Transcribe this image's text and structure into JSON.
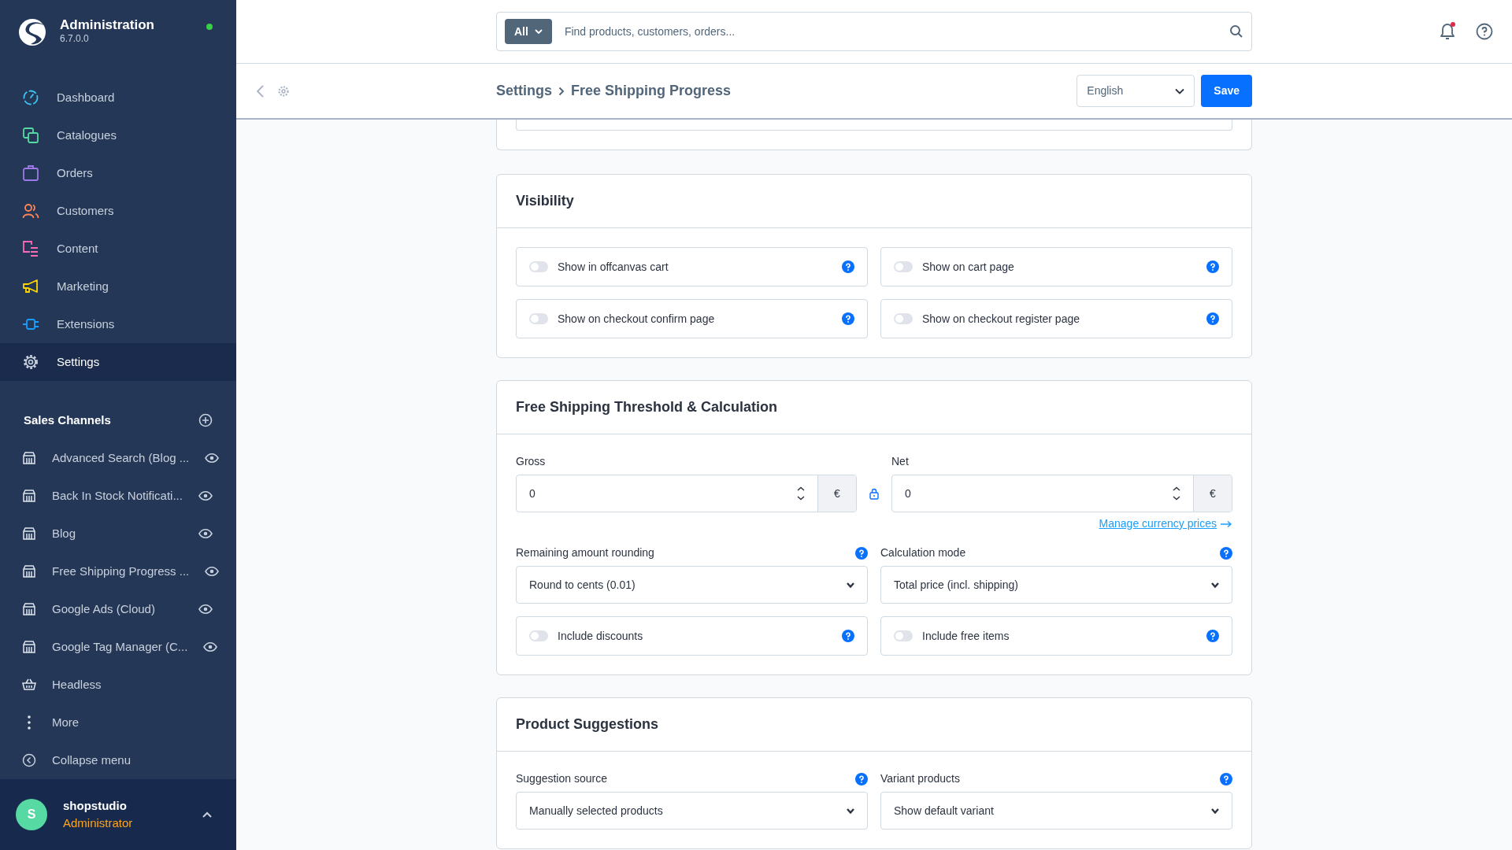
{
  "sidebar": {
    "brand": {
      "title": "Administration",
      "version": "6.7.0.0",
      "online": true
    },
    "nav": [
      {
        "label": "Dashboard",
        "selected": false
      },
      {
        "label": "Catalogues",
        "selected": false
      },
      {
        "label": "Orders",
        "selected": false
      },
      {
        "label": "Customers",
        "selected": false
      },
      {
        "label": "Content",
        "selected": false
      },
      {
        "label": "Marketing",
        "selected": false
      },
      {
        "label": "Extensions",
        "selected": false
      },
      {
        "label": "Settings",
        "selected": true
      }
    ],
    "sales_channels": {
      "title": "Sales Channels",
      "items": [
        {
          "label": "Advanced Search (Blog ...",
          "kind": "storefront"
        },
        {
          "label": "Back In Stock Notificati...",
          "kind": "storefront"
        },
        {
          "label": "Blog",
          "kind": "storefront"
        },
        {
          "label": "Free Shipping Progress ...",
          "kind": "storefront"
        },
        {
          "label": "Google Ads (Cloud)",
          "kind": "storefront"
        },
        {
          "label": "Google Tag Manager (C...",
          "kind": "storefront"
        },
        {
          "label": "Headless",
          "kind": "headless"
        }
      ]
    },
    "more": "More",
    "collapse": "Collapse menu",
    "user": {
      "initial": "S",
      "name": "shopstudio",
      "role": "Administrator"
    }
  },
  "topbar": {
    "search_scope": "All",
    "search": {
      "placeholder": "Find products, customers, orders..."
    },
    "notifications_unread": true
  },
  "header": {
    "breadcrumb": [
      "Settings",
      "Free Shipping Progress"
    ],
    "language": "English",
    "save": "Save"
  },
  "sections": [
    {
      "title": "Visibility",
      "rows": [
        {
          "kind": "toggles",
          "items": [
            {
              "label": "Show in offcanvas cart",
              "on": false
            },
            {
              "label": "Show on cart page",
              "on": false
            }
          ]
        },
        {
          "kind": "toggles",
          "items": [
            {
              "label": "Show on checkout confirm page",
              "on": false
            },
            {
              "label": "Show on checkout register page",
              "on": false
            }
          ]
        }
      ]
    },
    {
      "title": "Free Shipping Threshold & Calculation",
      "rows": [
        {
          "kind": "prices",
          "gross": {
            "label": "Gross",
            "value": "0",
            "currency": "€"
          },
          "net": {
            "label": "Net",
            "value": "0",
            "currency": "€"
          },
          "locked": true,
          "link": "Manage currency prices"
        },
        {
          "kind": "selects",
          "items": [
            {
              "label": "Remaining amount rounding",
              "value": "Round to cents (0.01)"
            },
            {
              "label": "Calculation mode",
              "value": "Total price (incl. shipping)"
            }
          ]
        },
        {
          "kind": "toggles",
          "items": [
            {
              "label": "Include discounts",
              "on": false
            },
            {
              "label": "Include free items",
              "on": false
            }
          ]
        }
      ]
    },
    {
      "title": "Product Suggestions",
      "rows": [
        {
          "kind": "selects",
          "items": [
            {
              "label": "Suggestion source",
              "value": "Manually selected products"
            },
            {
              "label": "Variant products",
              "value": "Show default variant"
            }
          ]
        }
      ]
    }
  ]
}
